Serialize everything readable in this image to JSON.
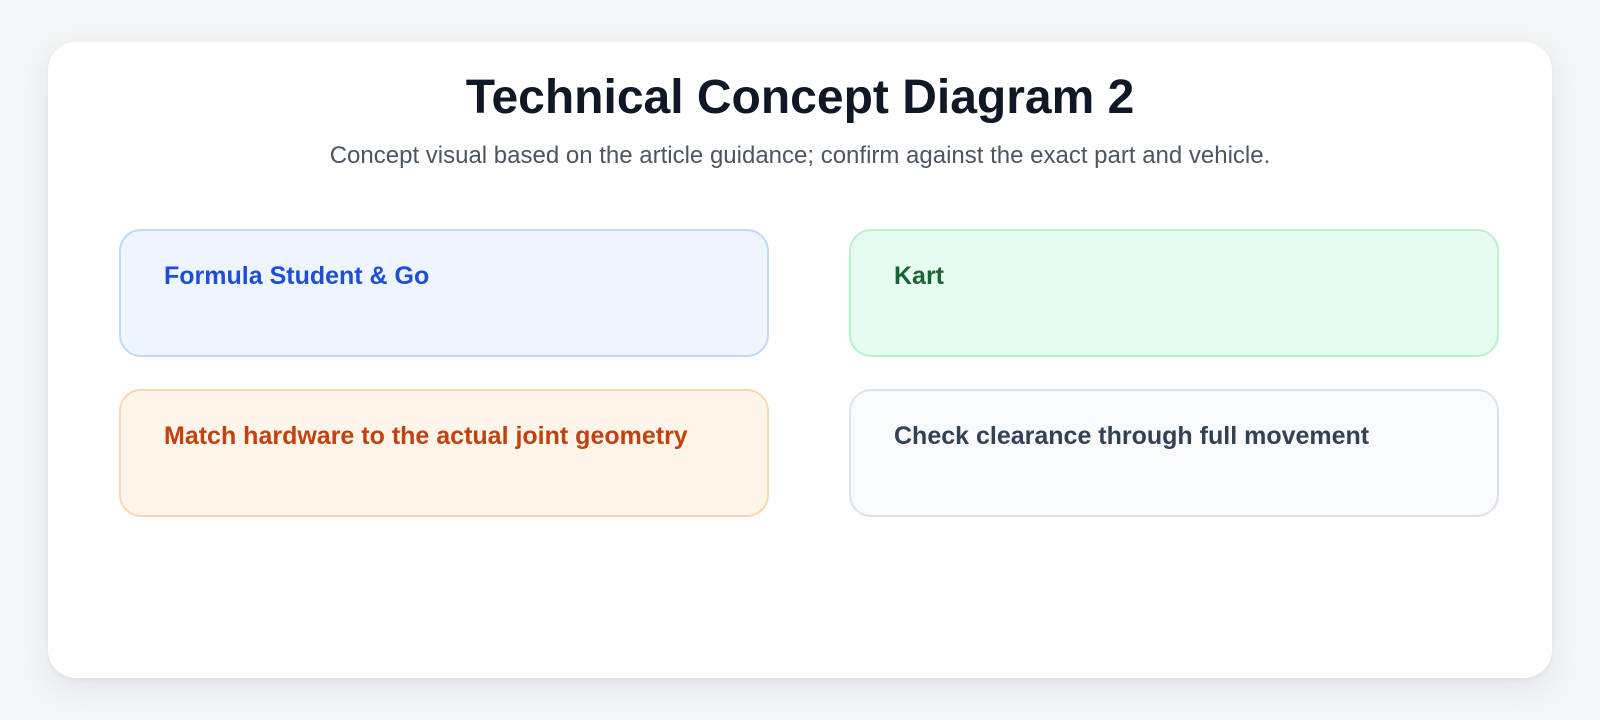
{
  "title": "Technical Concept Diagram 2",
  "subtitle": "Concept visual based on the article guidance; confirm against the exact part and vehicle.",
  "boxes": [
    {
      "label": "Formula Student & Go",
      "color": "#1d4ed8",
      "background": "#eef5fe",
      "border": "#bfd9f7"
    },
    {
      "label": "Kart",
      "color": "#166534",
      "background": "#e8fbf1",
      "border": "#b8f1cd"
    },
    {
      "label": "Match hardware to the actual joint geometry",
      "color": "#c2410c",
      "background": "#fef5ea",
      "border": "#fbd8ab"
    },
    {
      "label": "Check clearance through full movement",
      "color": "#334155",
      "background": "#f8fafc",
      "border": "#dbe3ec"
    }
  ]
}
